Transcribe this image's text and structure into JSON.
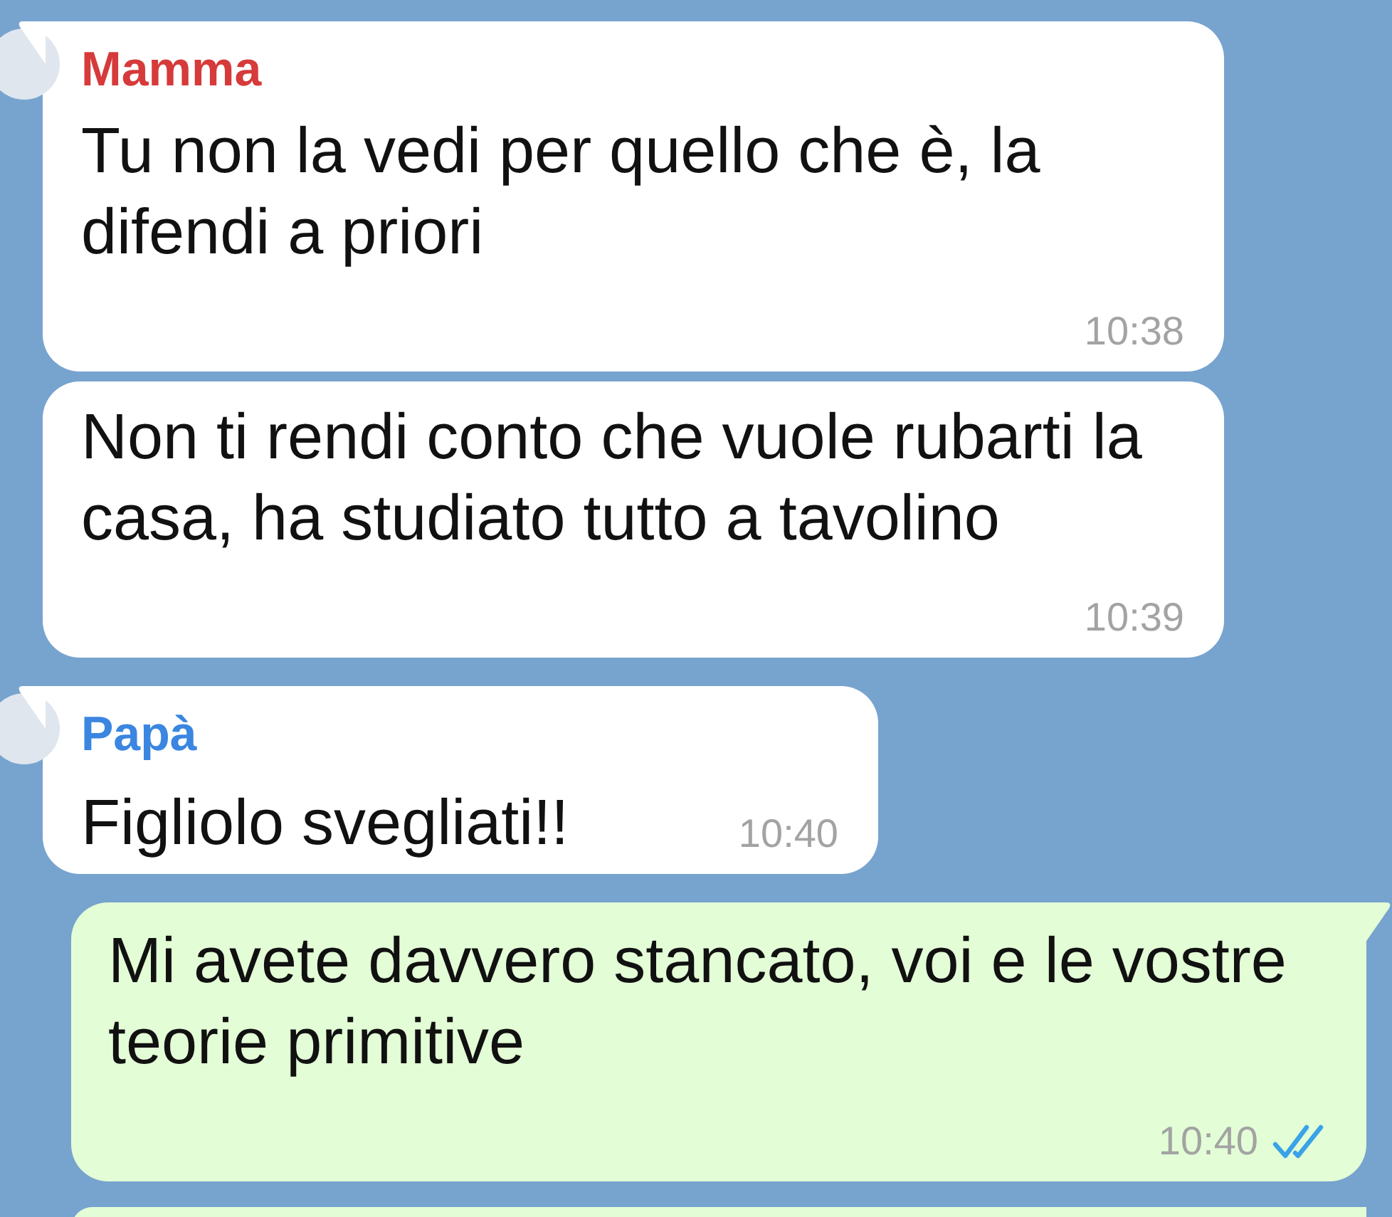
{
  "groups": [
    {
      "kind": "incoming",
      "sender": "Mamma",
      "color": "#d63a3a",
      "messages": [
        {
          "text": "Tu non la vedi per quello che è, la difendi a priori",
          "time": "10:38"
        },
        {
          "text": "Non ti rendi conto che vuole rubarti la casa, ha studiato tutto a tavolino",
          "time": "10:39"
        }
      ]
    },
    {
      "kind": "incoming",
      "sender": "Papà",
      "color": "#3a86e0",
      "messages": [
        {
          "text": "Figliolo svegliati!!",
          "time": "10:40"
        }
      ]
    },
    {
      "kind": "outgoing",
      "messages": [
        {
          "text": "Mi avete davvero stancato, voi e le vostre teorie primitive",
          "time": "10:40",
          "read": true
        }
      ]
    }
  ]
}
